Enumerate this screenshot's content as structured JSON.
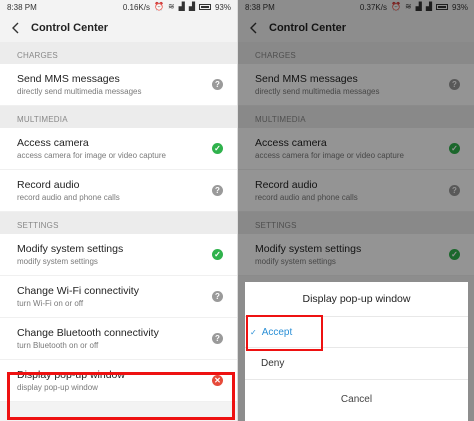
{
  "left": {
    "status": {
      "time": "8:38 PM",
      "speed": "0.16K/s",
      "battery": "93%"
    },
    "header": {
      "title": "Control Center"
    },
    "sections": [
      {
        "label": "CHARGES"
      },
      {
        "label": "MULTIMEDIA"
      },
      {
        "label": "SETTINGS"
      }
    ],
    "items": [
      {
        "title": "Send MMS messages",
        "subtitle": "directly send multimedia messages",
        "status": "ask"
      },
      {
        "title": "Access camera",
        "subtitle": "access camera for image or video capture",
        "status": "allowed"
      },
      {
        "title": "Record audio",
        "subtitle": "record audio and phone calls",
        "status": "ask"
      },
      {
        "title": "Modify system settings",
        "subtitle": "modify system settings",
        "status": "allowed"
      },
      {
        "title": "Change Wi-Fi connectivity",
        "subtitle": "turn Wi-Fi on or off",
        "status": "ask"
      },
      {
        "title": "Change Bluetooth connectivity",
        "subtitle": "turn Bluetooth on or off",
        "status": "ask"
      },
      {
        "title": "Display pop-up window",
        "subtitle": "display pop-up window",
        "status": "denied"
      }
    ]
  },
  "right": {
    "status": {
      "time": "8:38 PM",
      "speed": "0.37K/s",
      "battery": "93%"
    },
    "header": {
      "title": "Control Center"
    },
    "sections": [
      {
        "label": "CHARGES"
      },
      {
        "label": "MULTIMEDIA"
      },
      {
        "label": "SETTINGS"
      }
    ],
    "items": [
      {
        "title": "Send MMS messages",
        "subtitle": "directly send multimedia messages"
      },
      {
        "title": "Access camera",
        "subtitle": "access camera for image or video capture"
      },
      {
        "title": "Record audio",
        "subtitle": "record audio and phone calls"
      },
      {
        "title": "Modify system settings",
        "subtitle": "modify system settings"
      }
    ],
    "dialog": {
      "title": "Display pop-up window",
      "options": [
        "Accept",
        "Deny"
      ],
      "cancel": "Cancel"
    }
  },
  "icons": {
    "ask": "question-icon",
    "allowed": "check-icon",
    "denied": "close-icon"
  },
  "colors": {
    "allowed": "#2fb24c",
    "denied": "#e64a3a",
    "ask": "#9a9a9a",
    "accent": "#2a8fd6",
    "highlight": "#ee1111"
  }
}
